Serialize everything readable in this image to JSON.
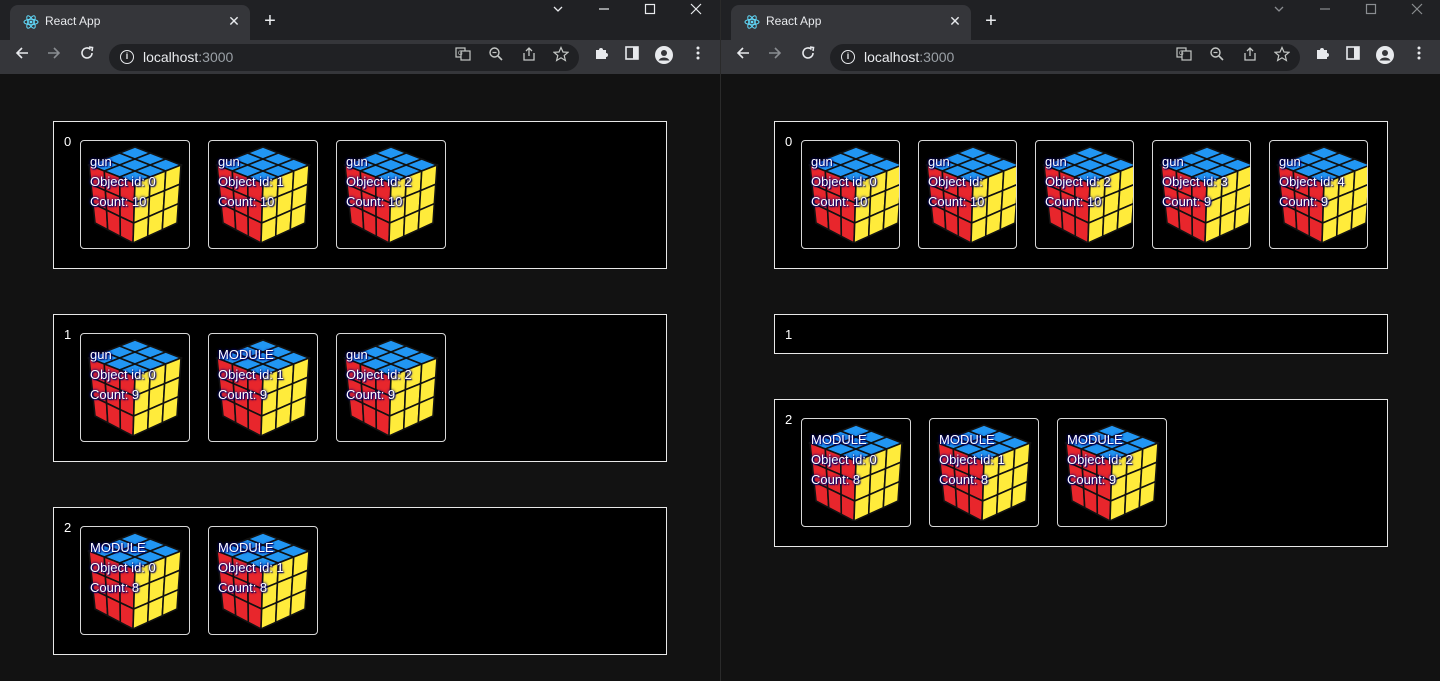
{
  "browser": {
    "tab_title": "React App",
    "tab_close": "✕",
    "new_tab": "+",
    "url_host": "localhost",
    "url_port": ":3000",
    "info_glyph": "i"
  },
  "icons": {
    "back": "back-arrow-icon",
    "forward": "forward-arrow-icon",
    "reload": "reload-icon",
    "translate": "translate-icon",
    "zoom": "zoom-out-icon",
    "share": "share-icon",
    "star": "bookmark-star-icon",
    "extensions": "extensions-puzzle-icon",
    "sidepanel": "side-panel-icon",
    "profile": "profile-icon",
    "menu": "kebab-menu-icon"
  },
  "colors": {
    "page_bg": "#121212",
    "panel_bg": "#000000",
    "border": "#e8e8e8",
    "cube_top": "#2196f3",
    "cube_left": "#e8262c",
    "cube_right": "#ffeb3b"
  },
  "card_labels": {
    "object_id_prefix": "Object id: ",
    "count_prefix": "Count: "
  },
  "left": {
    "groups": [
      {
        "index": "0",
        "cards": [
          {
            "name": "gun",
            "id": "0",
            "count": "10"
          },
          {
            "name": "gun",
            "id": "1",
            "count": "10"
          },
          {
            "name": "gun",
            "id": "2",
            "count": "10"
          }
        ]
      },
      {
        "index": "1",
        "cards": [
          {
            "name": "gun",
            "id": "0",
            "count": "9"
          },
          {
            "name": "MODULE",
            "id": "1",
            "count": "9"
          },
          {
            "name": "gun",
            "id": "2",
            "count": "9"
          }
        ]
      },
      {
        "index": "2",
        "cards": [
          {
            "name": "MODULE",
            "id": "0",
            "count": "8"
          },
          {
            "name": "MODULE",
            "id": "1",
            "count": "8"
          }
        ]
      }
    ]
  },
  "right": {
    "groups": [
      {
        "index": "0",
        "cards": [
          {
            "name": "gun",
            "id": "0",
            "count": "10"
          },
          {
            "name": "gun",
            "id": "",
            "count": "10"
          },
          {
            "name": "gun",
            "id": "2",
            "count": "10"
          },
          {
            "name": "gun",
            "id": "3",
            "count": "9"
          },
          {
            "name": "gun",
            "id": "4",
            "count": "9"
          }
        ]
      },
      {
        "index": "1",
        "cards": []
      },
      {
        "index": "2",
        "cards": [
          {
            "name": "MODULE",
            "id": "0",
            "count": "8"
          },
          {
            "name": "MODULE",
            "id": "1",
            "count": "8"
          },
          {
            "name": "MODULE",
            "id": "2",
            "count": "9"
          }
        ]
      }
    ]
  }
}
